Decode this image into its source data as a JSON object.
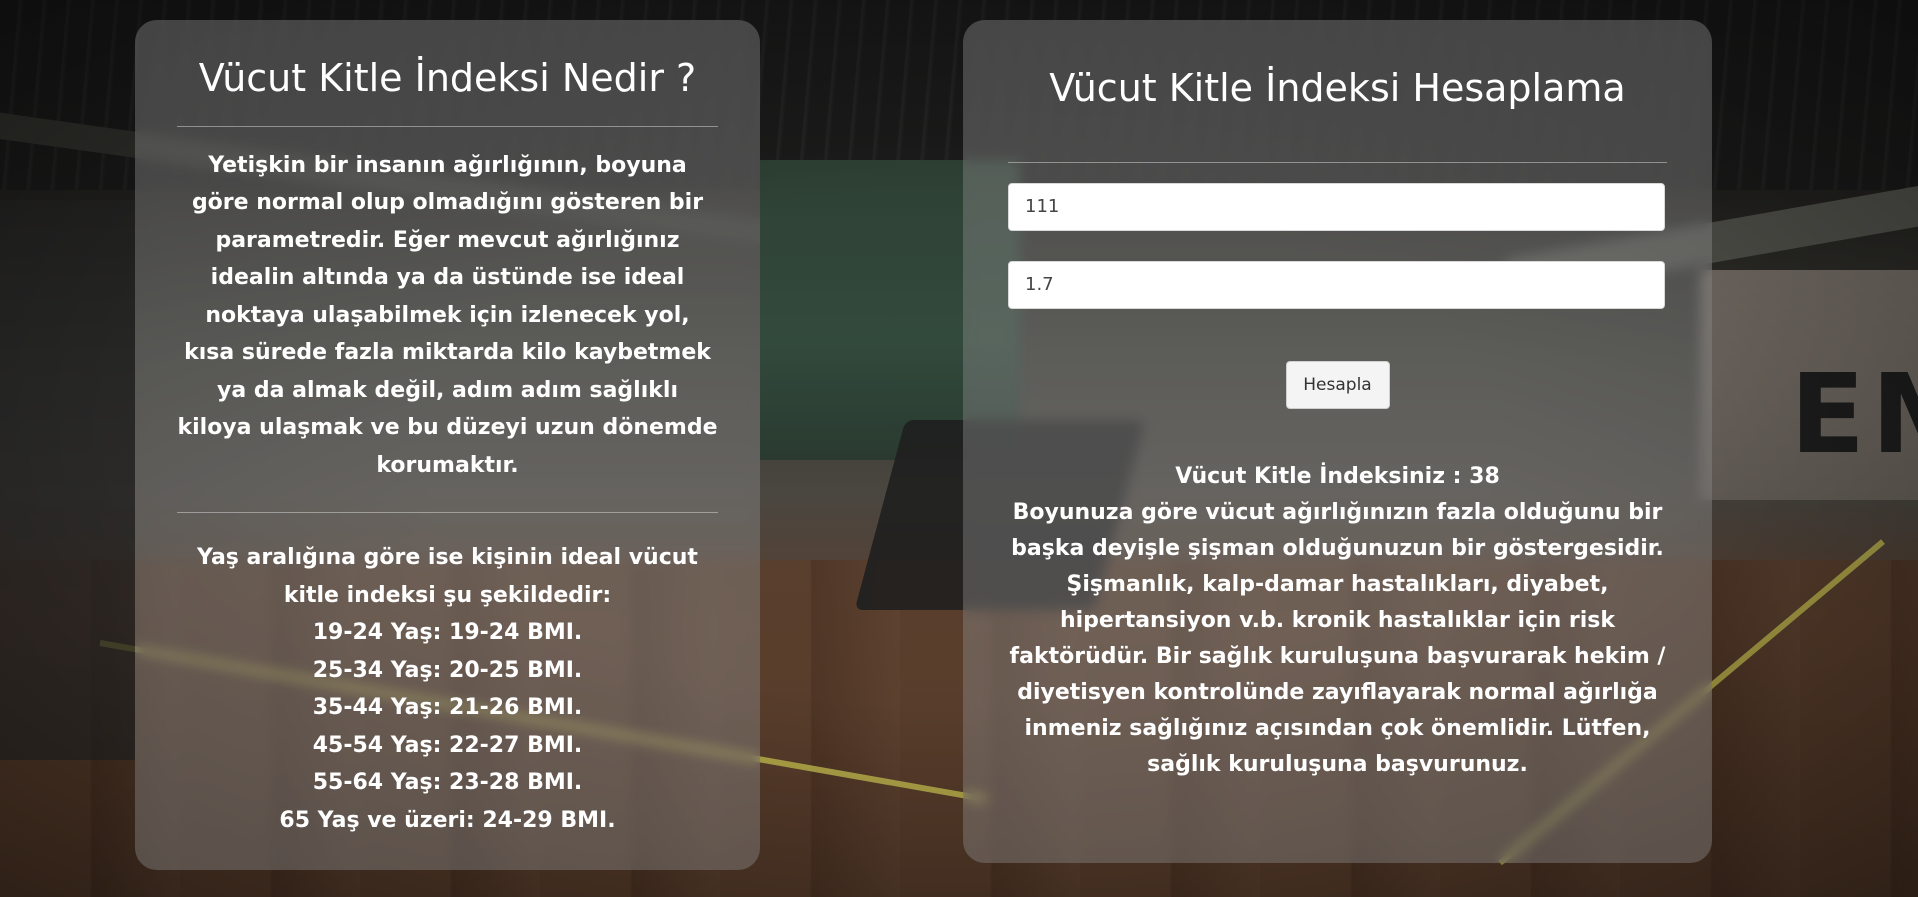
{
  "info_card": {
    "title": "Vücut Kitle İndeksi Nedir ?",
    "description": "Yetişkin bir insanın ağırlığının, boyuna göre normal olup olmadığını gösteren bir parametredir. Eğer mevcut ağırlığınız idealin altında ya da üstünde ise ideal noktaya ulaşabilmek için izlenecek yol, kısa sürede fazla miktarda kilo kaybetmek ya da almak değil, adım adım sağlıklı kiloya ulaşmak ve bu düzeyi uzun dönemde korumaktır.",
    "age_intro": "Yaş aralığına göre ise kişinin ideal vücut kitle indeksi şu şekildedir:",
    "age_ranges": [
      "19-24 Yaş: 19-24 BMI.",
      "25-34 Yaş: 20-25 BMI.",
      "35-44 Yaş: 21-26 BMI.",
      "45-54 Yaş: 22-27 BMI.",
      "55-64 Yaş: 23-28 BMI.",
      "65 Yaş ve üzeri: 24-29 BMI."
    ]
  },
  "calc_card": {
    "title": "Vücut Kitle İndeksi Hesaplama",
    "weight_value": "111",
    "height_value": "1.7",
    "button_label": "Hesapla",
    "result_label": "Vücut Kitle İndeksiniz : 38",
    "result_description": "Boyunuza göre vücut ağırlığınızın fazla olduğunu bir başka deyişle şişman olduğunuzun bir göstergesidir. Şişmanlık, kalp-damar hastalıkları, diyabet, hipertansiyon v.b. kronik hastalıklar için risk faktörüdür. Bir sağlık kuruluşuna başvurarak hekim / diyetisyen kontrolünde zayıflayarak normal ağırlığa inmeniz sağlığınız açısından çok önemlidir. Lütfen, sağlık kuruluşuna başvurunuz."
  }
}
